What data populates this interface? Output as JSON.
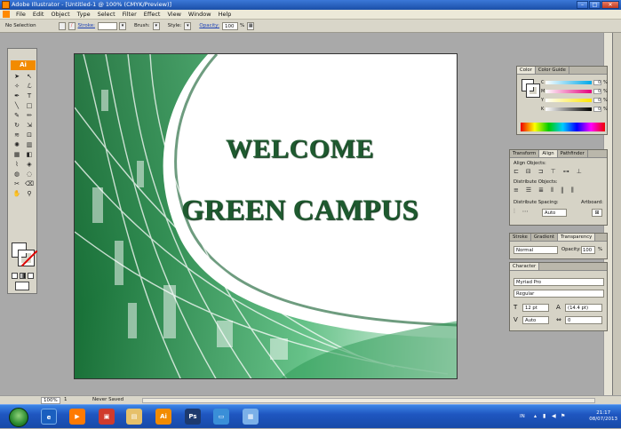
{
  "window": {
    "title": "Adobe Illustrator - [Untitled-1 @ 100% (CMYK/Preview)]"
  },
  "menu": [
    "File",
    "Edit",
    "Object",
    "Type",
    "Select",
    "Filter",
    "Effect",
    "View",
    "Window",
    "Help"
  ],
  "control_bar": {
    "selection": "No Selection",
    "stroke_label": "Stroke:",
    "brush_label": "Brush:",
    "style_label": "Style:",
    "opacity_label": "Opacity:",
    "opacity_value": "100",
    "opacity_unit": "%"
  },
  "toolbox": {
    "badge": "Ai"
  },
  "artboard": {
    "line1": "WELCOME",
    "line2": "GREEN CAMPUS",
    "colors": {
      "text": "#1e5a2f",
      "green_dark": "#1d7a3e",
      "green_light": "#8fd3a6"
    }
  },
  "color_panel": {
    "tabs": [
      "Color",
      "Color Guide"
    ],
    "channels": [
      {
        "label": "C",
        "value": "0",
        "unit": "%"
      },
      {
        "label": "M",
        "value": "0",
        "unit": "%"
      },
      {
        "label": "Y",
        "value": "0",
        "unit": "%"
      },
      {
        "label": "K",
        "value": "0",
        "unit": "%"
      }
    ]
  },
  "align_panel": {
    "tabs": [
      "Transform",
      "Align",
      "Pathfinder"
    ],
    "align_objects": "Align Objects:",
    "distribute_objects": "Distribute Objects:",
    "distribute_spacing": "Distribute Spacing:",
    "artboard": "Artboard:",
    "spacing_value": "Auto"
  },
  "transparency_panel": {
    "tabs": [
      "Stroke",
      "Gradient",
      "Transparency"
    ],
    "blend_mode": "Normal",
    "opacity_label": "Opacity:",
    "opacity_value": "100",
    "unit": "%"
  },
  "character_panel": {
    "tab": "Character",
    "font": "Myriad Pro",
    "style": "Regular",
    "size": "12 pt",
    "leading": "(14.4 pt)",
    "kerning": "Auto",
    "tracking": "0"
  },
  "status_bar": {
    "zoom": "100%",
    "page": "1",
    "save_state": "Never Saved"
  },
  "taskbar": {
    "language": "IN",
    "time": "21:17",
    "date": "08/07/2013"
  }
}
